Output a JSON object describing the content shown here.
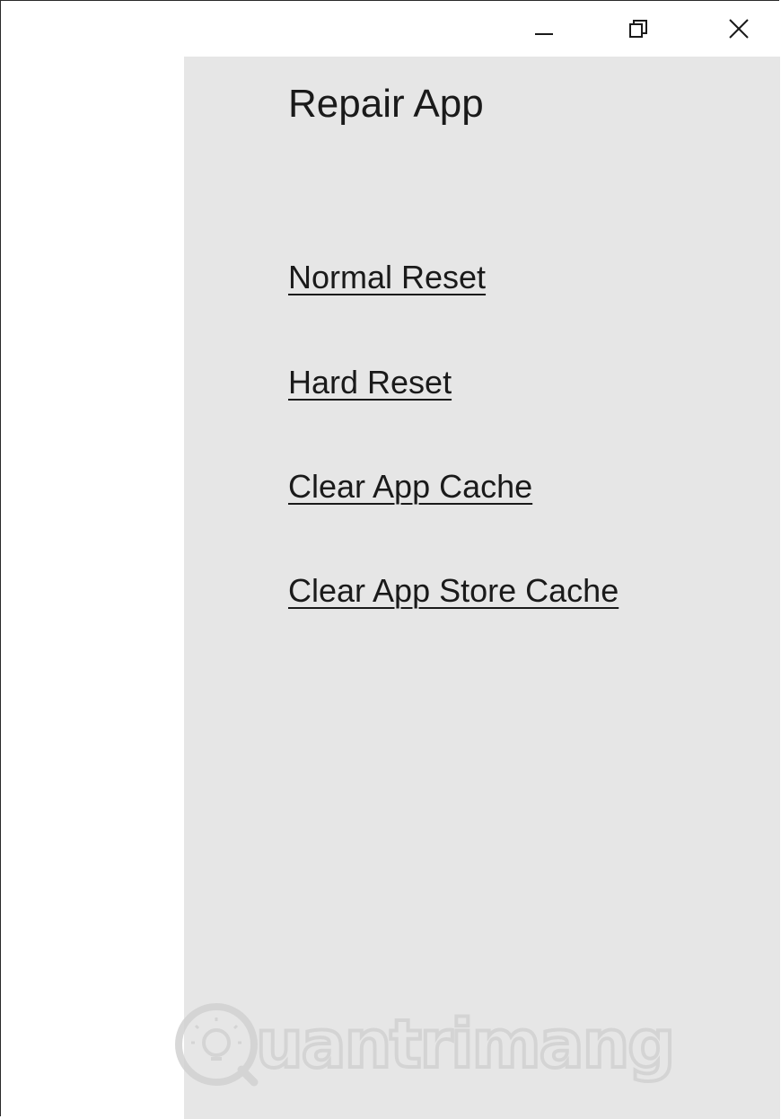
{
  "titlebar": {
    "minimize_icon": "minimize-icon",
    "maximize_icon": "restore-icon",
    "close_icon": "close-icon"
  },
  "page": {
    "title": "Repair App"
  },
  "actions": [
    {
      "label": "Normal Reset"
    },
    {
      "label": "Hard Reset"
    },
    {
      "label": "Clear App Cache"
    },
    {
      "label": "Clear App Store Cache"
    }
  ],
  "watermark": {
    "text": "uantrimang",
    "icon": "lightbulb-icon"
  },
  "colors": {
    "content_background": "#e6e6e6",
    "window_background": "#ffffff",
    "text": "#1a1a1a"
  }
}
